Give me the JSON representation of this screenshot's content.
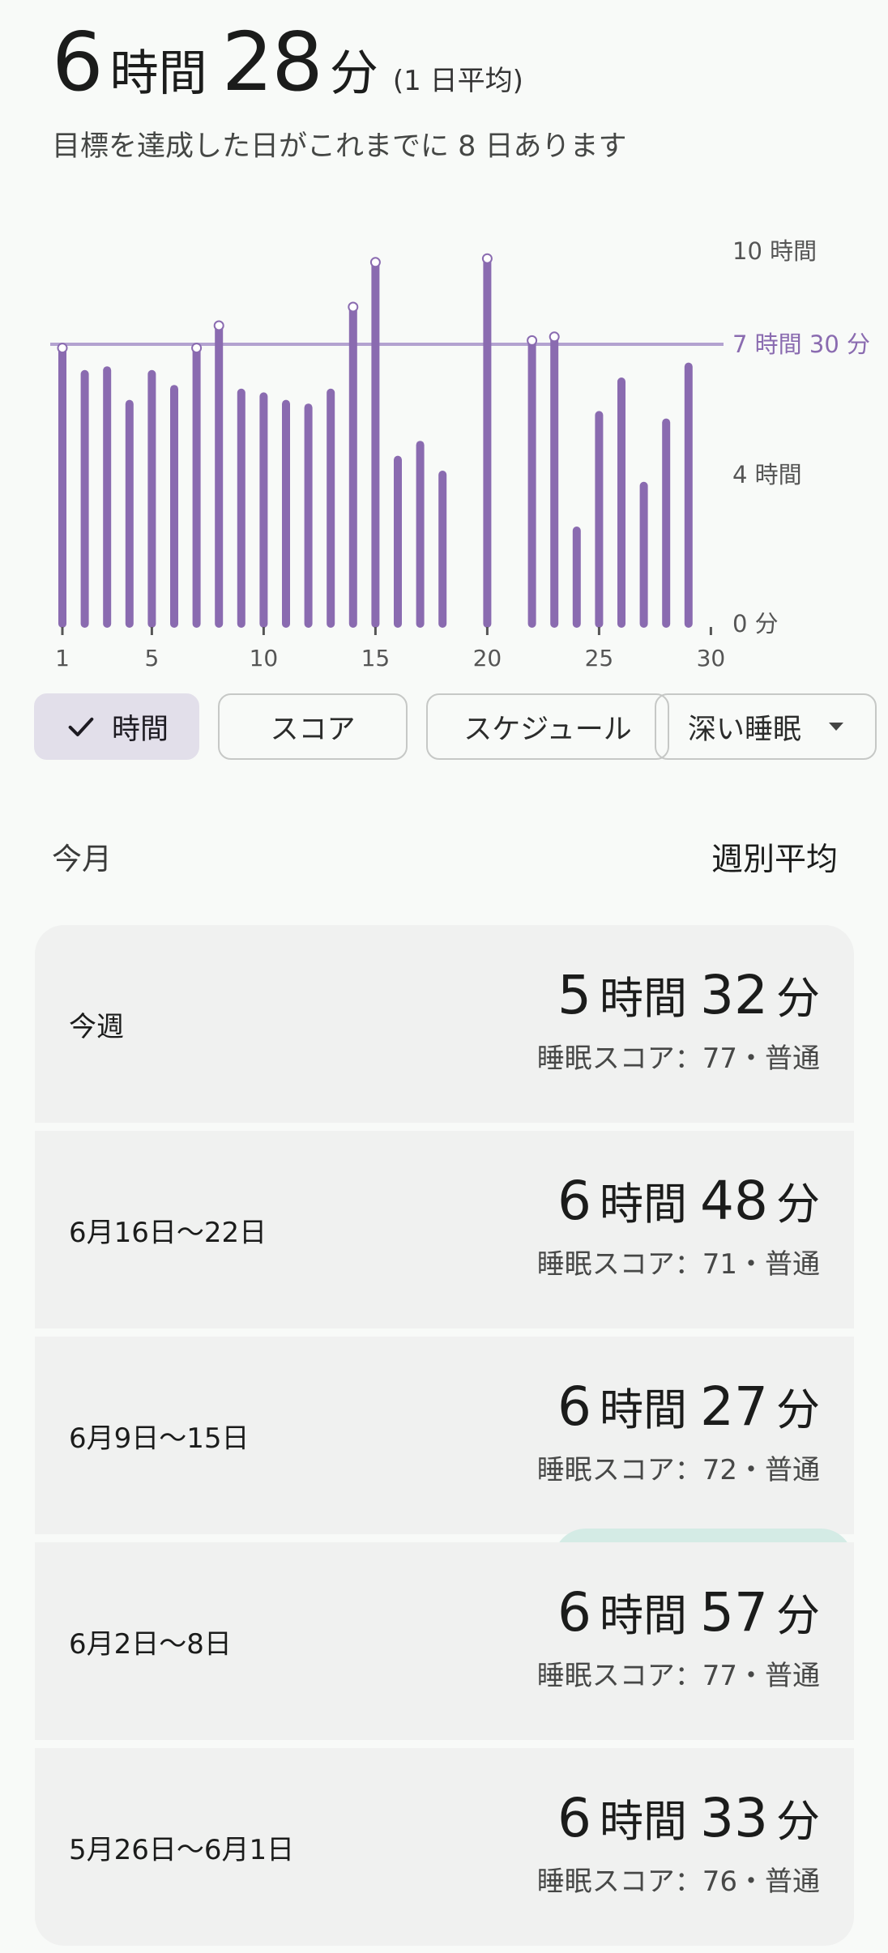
{
  "header": {
    "hours": "6",
    "hours_unit": "時間",
    "minutes": "28",
    "minutes_unit": "分",
    "avg_note": "(1 日平均)",
    "goal_text": "目標を達成した日がこれまでに 8 日あります"
  },
  "chart_data": {
    "type": "bar",
    "categories": [
      1,
      2,
      3,
      4,
      5,
      6,
      7,
      8,
      9,
      10,
      11,
      12,
      13,
      14,
      15,
      16,
      17,
      18,
      19,
      20,
      21,
      22,
      23,
      24,
      25,
      26,
      27,
      28,
      29,
      30
    ],
    "values": [
      7.4,
      6.7,
      6.8,
      5.9,
      6.7,
      6.3,
      7.4,
      8.0,
      6.2,
      6.1,
      5.9,
      5.8,
      6.2,
      8.5,
      9.7,
      4.4,
      4.8,
      4.0,
      null,
      9.8,
      null,
      7.6,
      7.7,
      2.5,
      5.6,
      6.5,
      3.7,
      5.4,
      6.9,
      null
    ],
    "goal_markers": [
      1,
      7,
      8,
      14,
      15,
      20,
      22,
      23
    ],
    "x_ticks": [
      "1",
      "5",
      "10",
      "15",
      "20",
      "25",
      "30"
    ],
    "y_ticks": [
      "0 分",
      "4 時間",
      "10 時間"
    ],
    "ylim": [
      0,
      10
    ],
    "goal_line": {
      "value": 7.5,
      "label": "7 時間 30 分"
    },
    "color": "#8a6bb0",
    "goal_color": "#b3a2d0"
  },
  "chips": [
    {
      "label": "時間",
      "selected": true
    },
    {
      "label": "スコア",
      "selected": false
    },
    {
      "label": "スケジュール",
      "selected": false
    },
    {
      "label": "深い睡眠",
      "selected": false,
      "dropdown": true
    }
  ],
  "section": {
    "left": "今月",
    "right": "週別平均"
  },
  "weeks": [
    {
      "label": "今週",
      "hours": "5",
      "minutes": "32",
      "score": "睡眠スコア：77・普通"
    },
    {
      "label": "6月16日〜22日",
      "hours": "6",
      "minutes": "48",
      "score": "睡眠スコア：71・普通"
    },
    {
      "label": "6月9日〜15日",
      "hours": "6",
      "minutes": "27",
      "score": "睡眠スコア：72・普通"
    },
    {
      "label": "6月2日〜8日",
      "hours": "6",
      "minutes": "57",
      "score": "睡眠スコア：77・普通"
    },
    {
      "label": "5月26日〜6月1日",
      "hours": "6",
      "minutes": "33",
      "score": "睡眠スコア：76・普通"
    }
  ],
  "units": {
    "hours": "時間",
    "minutes": "分"
  }
}
